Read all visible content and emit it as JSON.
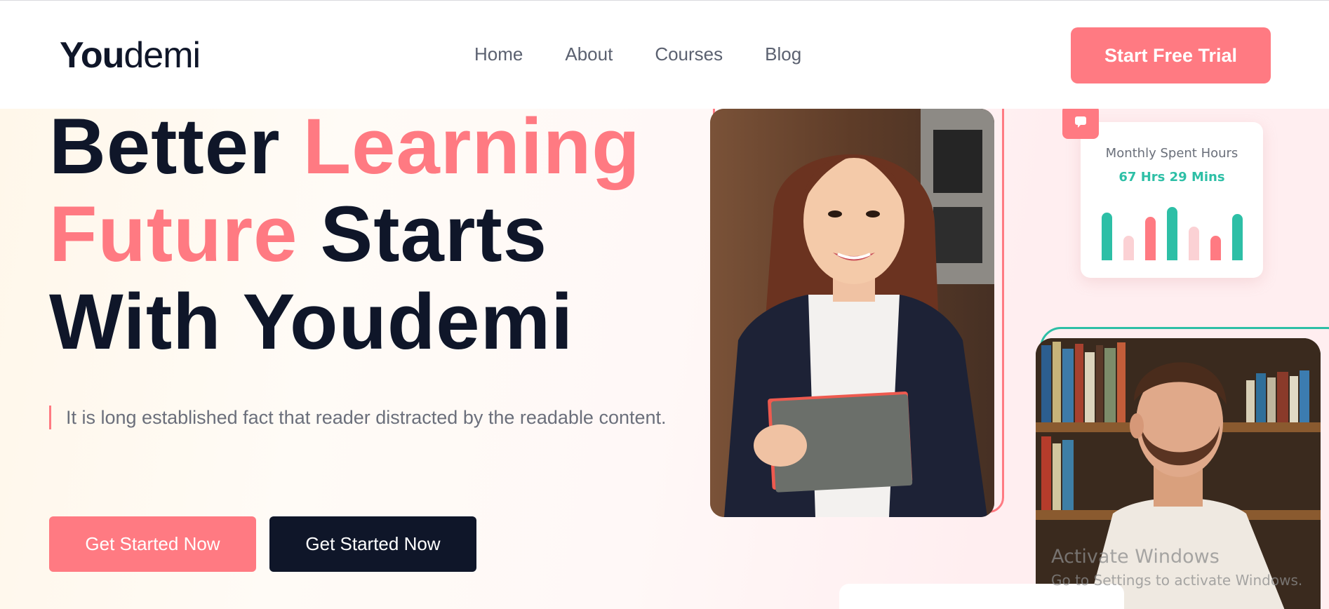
{
  "header": {
    "logo_bold": "You",
    "logo_light": "demi",
    "nav": [
      "Home",
      "About",
      "Courses",
      "Blog"
    ],
    "cta_label": "Start Free Trial"
  },
  "hero": {
    "headline": {
      "line1_dark": "Better ",
      "line1_pink": "Learning",
      "line2_pink": "Future",
      "line2_dark": " Starts",
      "line3_dark": "With Youdemi"
    },
    "description": "It is long established fact that reader distracted by the readable content.",
    "primary_button": "Get Started Now",
    "secondary_button": "Get Started Now"
  },
  "stats_card": {
    "title": "Monthly Spent Hours",
    "value": "67 Hrs 29 Mins",
    "bars_relative_height": [
      0.85,
      0.44,
      0.78,
      0.95,
      0.6,
      0.44,
      0.82
    ],
    "bar_colors": [
      "#2dbfa6",
      "#fbd1d4",
      "#ff7a82",
      "#2dbfa6",
      "#fbd1d4",
      "#ff7a82",
      "#2dbfa6"
    ]
  },
  "colors": {
    "accent_pink": "#ff7a82",
    "dark_navy": "#0f1629",
    "teal": "#2dbfa6"
  },
  "watermark": {
    "line1": "Activate Windows",
    "line2": "Go to Settings to activate Windows."
  }
}
